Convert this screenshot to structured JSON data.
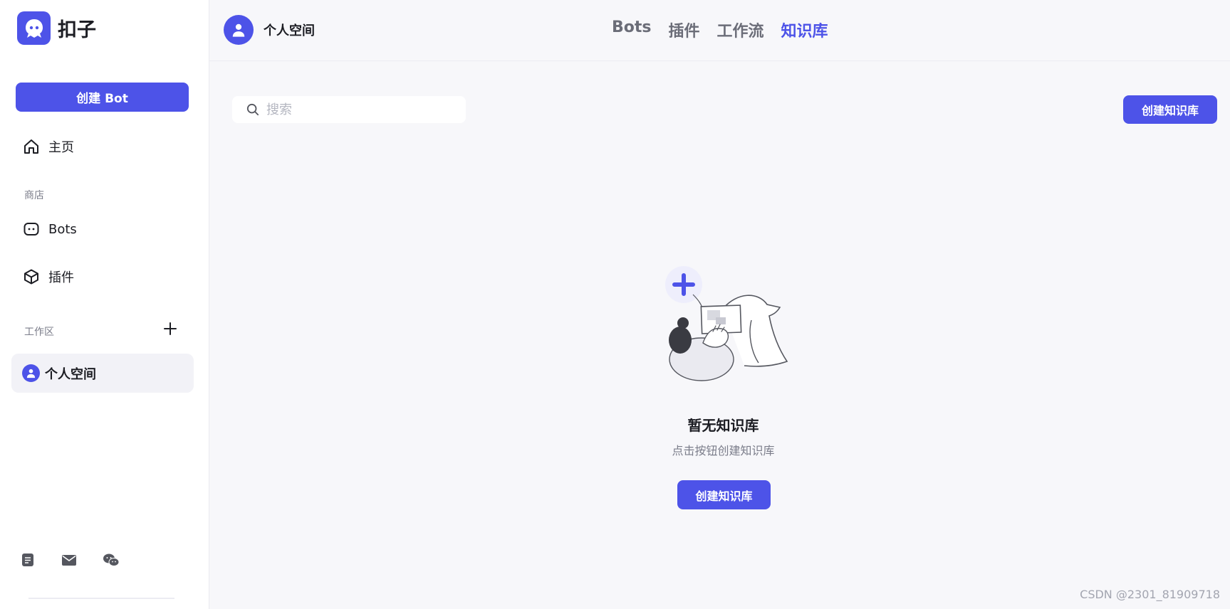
{
  "brand": {
    "name": "扣子"
  },
  "sidebar": {
    "create_bot_label": "创建 Bot",
    "home_label": "主页",
    "store_section": "商店",
    "store_items": [
      {
        "label": "Bots",
        "icon": "bot-icon"
      },
      {
        "label": "插件",
        "icon": "cube-icon"
      }
    ],
    "workspace_section": "工作区",
    "workspace_item": "个人空间",
    "footer_icons": [
      "document-icon",
      "mail-icon",
      "wechat-icon"
    ]
  },
  "header": {
    "space_name": "个人空间",
    "tabs": [
      {
        "label": "Bots",
        "active": false
      },
      {
        "label": "插件",
        "active": false
      },
      {
        "label": "工作流",
        "active": false
      },
      {
        "label": "知识库",
        "active": true
      }
    ]
  },
  "main": {
    "search": {
      "placeholder": "搜索",
      "value": ""
    },
    "create_kb_label": "创建知识库",
    "empty": {
      "title": "暂无知识库",
      "subtitle": "点击按钮创建知识库",
      "button_label": "创建知识库"
    }
  },
  "watermark": "CSDN @2301_81909718",
  "colors": {
    "accent": "#4d53e8",
    "sidebar_bg": "#ffffff",
    "content_bg": "#f7f7fa",
    "active_item_bg": "#f2f2f7"
  }
}
